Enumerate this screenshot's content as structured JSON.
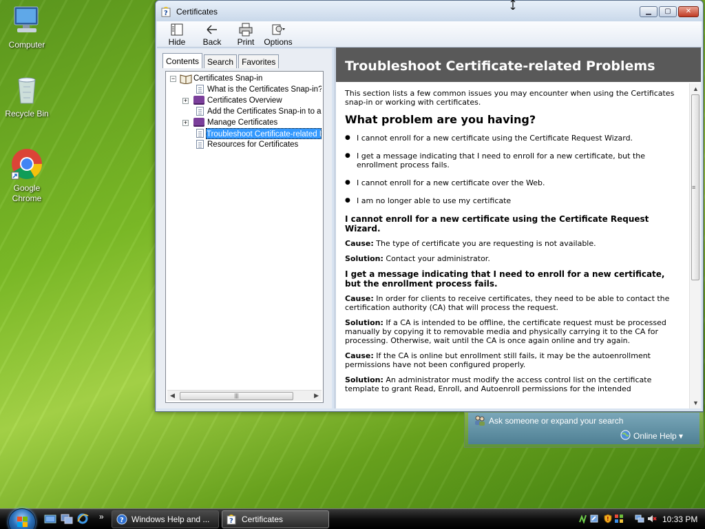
{
  "desktop": {
    "icons": [
      {
        "label": "Computer"
      },
      {
        "label": "Recycle Bin"
      },
      {
        "label": "Google Chrome"
      }
    ]
  },
  "window": {
    "title": "Certificates",
    "toolbar": {
      "hide": "Hide",
      "back": "Back",
      "print": "Print",
      "options": "Options"
    },
    "tabs": [
      "Contents",
      "Search",
      "Favorites"
    ],
    "tree": [
      {
        "label": "Certificates Snap-in",
        "type": "book-open",
        "level": 0
      },
      {
        "label": "What is the Certificates Snap-in?",
        "type": "page",
        "level": 1
      },
      {
        "label": "Certificates Overview",
        "type": "book",
        "level": 1
      },
      {
        "label": "Add the Certificates Snap-in to an M",
        "type": "page",
        "level": 1
      },
      {
        "label": "Manage Certificates",
        "type": "book",
        "level": 1
      },
      {
        "label": "Troubleshoot Certificate-related Pro",
        "type": "page",
        "level": 1,
        "selected": true
      },
      {
        "label": "Resources for Certificates",
        "type": "page",
        "level": 1
      }
    ],
    "content": {
      "heading": "Troubleshoot Certificate-related Problems",
      "intro": "This section lists a few common issues you may encounter when using the Certificates snap-in or working with certificates.",
      "question": "What problem are you having?",
      "bullets": [
        "I cannot enroll for a new certificate using the Certificate Request Wizard.",
        "I get a message indicating that I need to enroll for a new certificate, but the enrollment process fails.",
        "I cannot enroll for a new certificate over the Web.",
        "I am no longer able to use my certificate"
      ],
      "section1_title": "I cannot enroll for a new certificate using the Certificate Request Wizard.",
      "cause_label": "Cause:",
      "solution_label": "Solution:",
      "section1_cause": "The type of certificate you are requesting is not available.",
      "section1_solution": "Contact your administrator.",
      "section2_title": "I get a message indicating that I need to enroll for a new certificate, but the enrollment process fails.",
      "section2_cause1": "In order for clients to receive certificates, they need to be able to contact the certification authority (CA) that will process the request.",
      "section2_solution1": "If a CA is intended to be offline, the certificate request must be processed manually by copying it to removable media and physically carrying it to the CA for processing. Otherwise, wait until the CA is once again online and try again.",
      "section2_cause2": "If the CA is online but enrollment still fails, it may be the autoenrollment permissions have not been configured properly.",
      "section2_solution2": "An administrator must modify the access control list on the certificate template to grant Read, Enroll, and Autoenroll permissions for the intended"
    }
  },
  "askbar": {
    "prompt": "Ask someone or expand your search",
    "online_help": "Online Help ▾"
  },
  "taskbar": {
    "buttons": [
      {
        "label": "Windows Help and ..."
      },
      {
        "label": "Certificates"
      }
    ],
    "chevron": "»",
    "clock": "10:33 PM"
  }
}
